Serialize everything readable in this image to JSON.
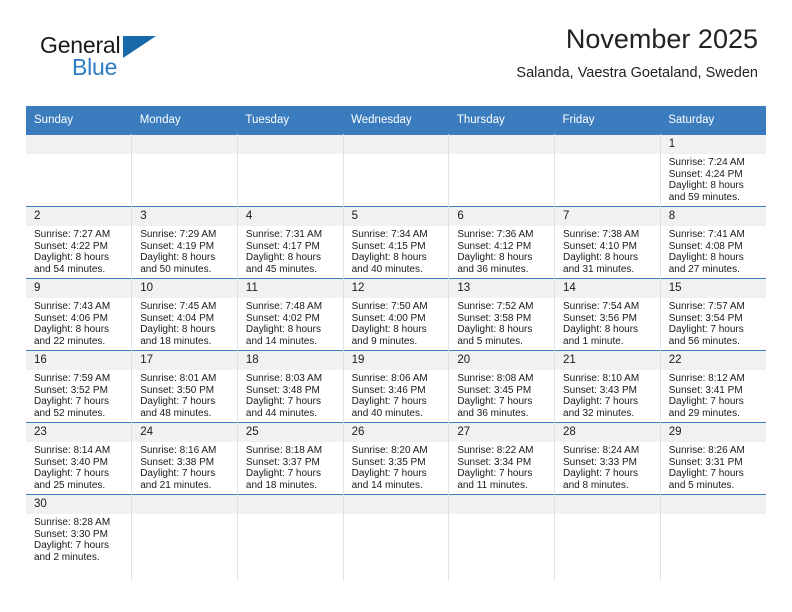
{
  "brand": {
    "name_top": "General",
    "name_bottom": "Blue",
    "triangle_color": "#1769aa",
    "blue_color": "#2b7cc4"
  },
  "header": {
    "title": "November 2025",
    "subtitle": "Salanda, Vaestra Goetaland, Sweden"
  },
  "theme": {
    "header_bg": "#3a7cbe",
    "daynum_bg": "#f1f1f1",
    "row_divider": "#3a7cbe"
  },
  "weekdays": [
    "Sunday",
    "Monday",
    "Tuesday",
    "Wednesday",
    "Thursday",
    "Friday",
    "Saturday"
  ],
  "weeks": [
    [
      {
        "day": "",
        "lines": []
      },
      {
        "day": "",
        "lines": []
      },
      {
        "day": "",
        "lines": []
      },
      {
        "day": "",
        "lines": []
      },
      {
        "day": "",
        "lines": []
      },
      {
        "day": "",
        "lines": []
      },
      {
        "day": "1",
        "lines": [
          "Sunrise: 7:24 AM",
          "Sunset: 4:24 PM",
          "Daylight: 8 hours",
          "and 59 minutes."
        ]
      }
    ],
    [
      {
        "day": "2",
        "lines": [
          "Sunrise: 7:27 AM",
          "Sunset: 4:22 PM",
          "Daylight: 8 hours",
          "and 54 minutes."
        ]
      },
      {
        "day": "3",
        "lines": [
          "Sunrise: 7:29 AM",
          "Sunset: 4:19 PM",
          "Daylight: 8 hours",
          "and 50 minutes."
        ]
      },
      {
        "day": "4",
        "lines": [
          "Sunrise: 7:31 AM",
          "Sunset: 4:17 PM",
          "Daylight: 8 hours",
          "and 45 minutes."
        ]
      },
      {
        "day": "5",
        "lines": [
          "Sunrise: 7:34 AM",
          "Sunset: 4:15 PM",
          "Daylight: 8 hours",
          "and 40 minutes."
        ]
      },
      {
        "day": "6",
        "lines": [
          "Sunrise: 7:36 AM",
          "Sunset: 4:12 PM",
          "Daylight: 8 hours",
          "and 36 minutes."
        ]
      },
      {
        "day": "7",
        "lines": [
          "Sunrise: 7:38 AM",
          "Sunset: 4:10 PM",
          "Daylight: 8 hours",
          "and 31 minutes."
        ]
      },
      {
        "day": "8",
        "lines": [
          "Sunrise: 7:41 AM",
          "Sunset: 4:08 PM",
          "Daylight: 8 hours",
          "and 27 minutes."
        ]
      }
    ],
    [
      {
        "day": "9",
        "lines": [
          "Sunrise: 7:43 AM",
          "Sunset: 4:06 PM",
          "Daylight: 8 hours",
          "and 22 minutes."
        ]
      },
      {
        "day": "10",
        "lines": [
          "Sunrise: 7:45 AM",
          "Sunset: 4:04 PM",
          "Daylight: 8 hours",
          "and 18 minutes."
        ]
      },
      {
        "day": "11",
        "lines": [
          "Sunrise: 7:48 AM",
          "Sunset: 4:02 PM",
          "Daylight: 8 hours",
          "and 14 minutes."
        ]
      },
      {
        "day": "12",
        "lines": [
          "Sunrise: 7:50 AM",
          "Sunset: 4:00 PM",
          "Daylight: 8 hours",
          "and 9 minutes."
        ]
      },
      {
        "day": "13",
        "lines": [
          "Sunrise: 7:52 AM",
          "Sunset: 3:58 PM",
          "Daylight: 8 hours",
          "and 5 minutes."
        ]
      },
      {
        "day": "14",
        "lines": [
          "Sunrise: 7:54 AM",
          "Sunset: 3:56 PM",
          "Daylight: 8 hours",
          "and 1 minute."
        ]
      },
      {
        "day": "15",
        "lines": [
          "Sunrise: 7:57 AM",
          "Sunset: 3:54 PM",
          "Daylight: 7 hours",
          "and 56 minutes."
        ]
      }
    ],
    [
      {
        "day": "16",
        "lines": [
          "Sunrise: 7:59 AM",
          "Sunset: 3:52 PM",
          "Daylight: 7 hours",
          "and 52 minutes."
        ]
      },
      {
        "day": "17",
        "lines": [
          "Sunrise: 8:01 AM",
          "Sunset: 3:50 PM",
          "Daylight: 7 hours",
          "and 48 minutes."
        ]
      },
      {
        "day": "18",
        "lines": [
          "Sunrise: 8:03 AM",
          "Sunset: 3:48 PM",
          "Daylight: 7 hours",
          "and 44 minutes."
        ]
      },
      {
        "day": "19",
        "lines": [
          "Sunrise: 8:06 AM",
          "Sunset: 3:46 PM",
          "Daylight: 7 hours",
          "and 40 minutes."
        ]
      },
      {
        "day": "20",
        "lines": [
          "Sunrise: 8:08 AM",
          "Sunset: 3:45 PM",
          "Daylight: 7 hours",
          "and 36 minutes."
        ]
      },
      {
        "day": "21",
        "lines": [
          "Sunrise: 8:10 AM",
          "Sunset: 3:43 PM",
          "Daylight: 7 hours",
          "and 32 minutes."
        ]
      },
      {
        "day": "22",
        "lines": [
          "Sunrise: 8:12 AM",
          "Sunset: 3:41 PM",
          "Daylight: 7 hours",
          "and 29 minutes."
        ]
      }
    ],
    [
      {
        "day": "23",
        "lines": [
          "Sunrise: 8:14 AM",
          "Sunset: 3:40 PM",
          "Daylight: 7 hours",
          "and 25 minutes."
        ]
      },
      {
        "day": "24",
        "lines": [
          "Sunrise: 8:16 AM",
          "Sunset: 3:38 PM",
          "Daylight: 7 hours",
          "and 21 minutes."
        ]
      },
      {
        "day": "25",
        "lines": [
          "Sunrise: 8:18 AM",
          "Sunset: 3:37 PM",
          "Daylight: 7 hours",
          "and 18 minutes."
        ]
      },
      {
        "day": "26",
        "lines": [
          "Sunrise: 8:20 AM",
          "Sunset: 3:35 PM",
          "Daylight: 7 hours",
          "and 14 minutes."
        ]
      },
      {
        "day": "27",
        "lines": [
          "Sunrise: 8:22 AM",
          "Sunset: 3:34 PM",
          "Daylight: 7 hours",
          "and 11 minutes."
        ]
      },
      {
        "day": "28",
        "lines": [
          "Sunrise: 8:24 AM",
          "Sunset: 3:33 PM",
          "Daylight: 7 hours",
          "and 8 minutes."
        ]
      },
      {
        "day": "29",
        "lines": [
          "Sunrise: 8:26 AM",
          "Sunset: 3:31 PM",
          "Daylight: 7 hours",
          "and 5 minutes."
        ]
      }
    ],
    [
      {
        "day": "30",
        "lines": [
          "Sunrise: 8:28 AM",
          "Sunset: 3:30 PM",
          "Daylight: 7 hours",
          "and 2 minutes."
        ]
      },
      {
        "day": "",
        "lines": []
      },
      {
        "day": "",
        "lines": []
      },
      {
        "day": "",
        "lines": []
      },
      {
        "day": "",
        "lines": []
      },
      {
        "day": "",
        "lines": []
      },
      {
        "day": "",
        "lines": []
      }
    ]
  ]
}
